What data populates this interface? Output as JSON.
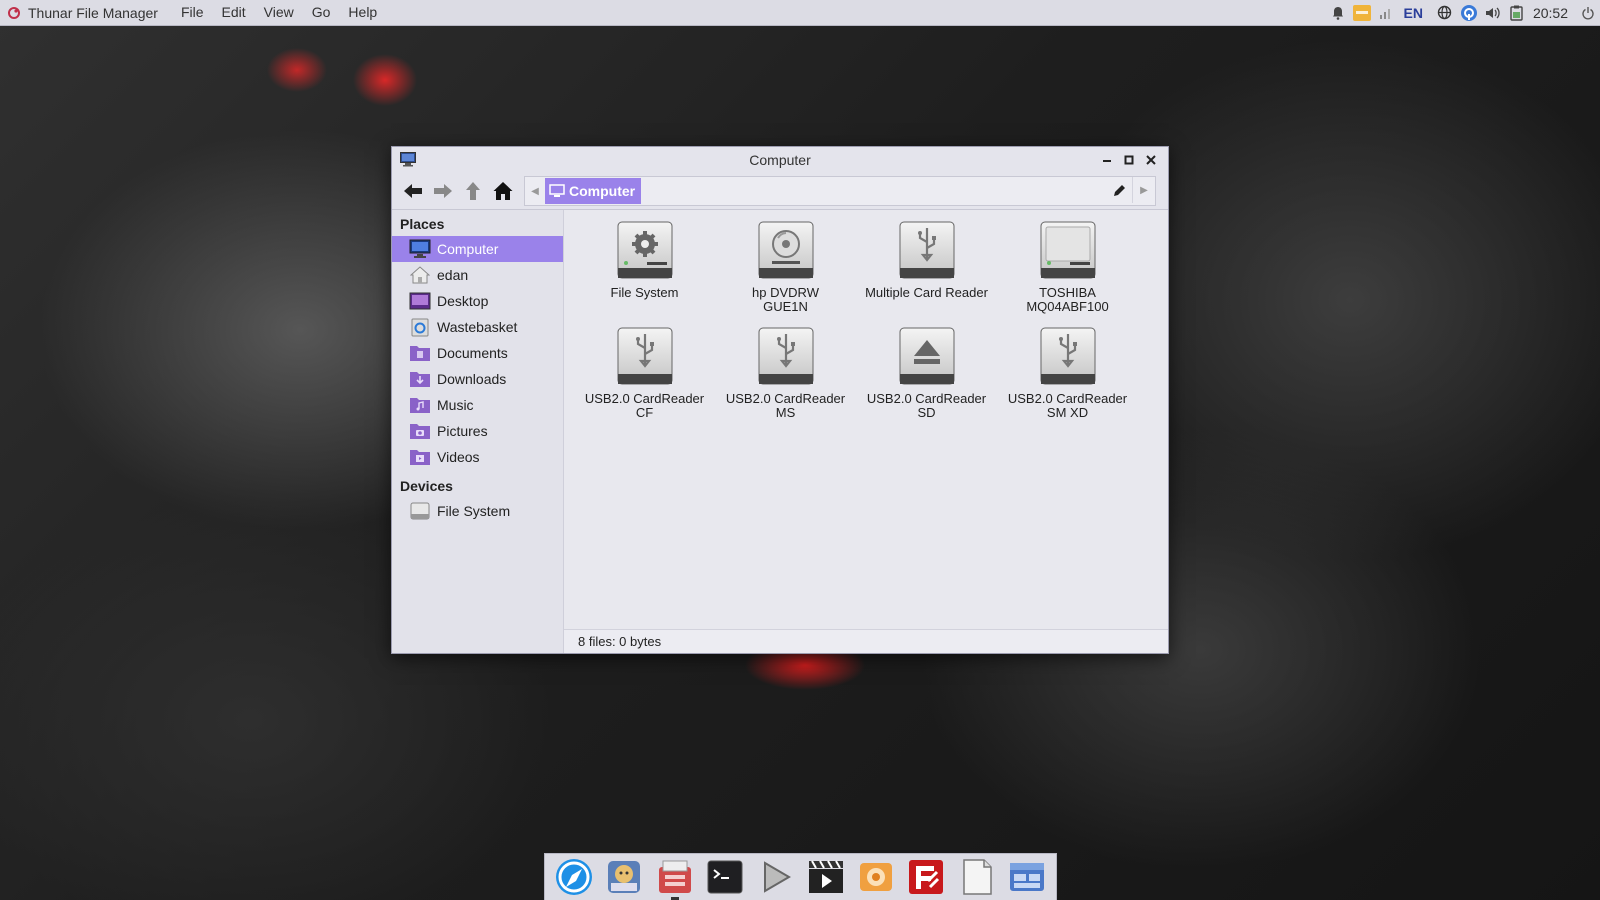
{
  "panel": {
    "app_name": "Thunar File Manager",
    "menu": [
      "File",
      "Edit",
      "View",
      "Go",
      "Help"
    ],
    "lang": "EN",
    "clock": "20:52"
  },
  "window": {
    "title": "Computer",
    "path_crumb": "Computer",
    "sidebar": {
      "places_title": "Places",
      "places": [
        "Computer",
        "edan",
        "Desktop",
        "Wastebasket",
        "Documents",
        "Downloads",
        "Music",
        "Pictures",
        "Videos"
      ],
      "devices_title": "Devices",
      "devices": [
        "File System"
      ]
    },
    "files": [
      {
        "label": "File System",
        "icon": "hard-drive-gear-icon"
      },
      {
        "label": "hp       DVDRW\nGUE1N",
        "icon": "optical-drive-icon"
      },
      {
        "label": "Multiple Card  Reader",
        "icon": "usb-drive-icon"
      },
      {
        "label": "TOSHIBA\nMQ04ABF100",
        "icon": "hard-disk-icon"
      },
      {
        "label": "USB2.0 CardReader\nCF",
        "icon": "usb-drive-icon"
      },
      {
        "label": "USB2.0 CardReader\nMS",
        "icon": "usb-drive-icon"
      },
      {
        "label": "USB2.0 CardReader\nSD",
        "icon": "eject-drive-icon"
      },
      {
        "label": "USB2.0 CardReader\nSM XD",
        "icon": "usb-drive-icon"
      }
    ],
    "status": "8 files: 0 bytes"
  },
  "colors": {
    "accent": "#9a82ea",
    "folder": "#8a62c8"
  },
  "dock": [
    "browser-icon",
    "mail-icon",
    "package-installer-icon",
    "terminal-icon",
    "media-player-icon",
    "video-player-icon",
    "image-viewer-icon",
    "filezilla-icon",
    "text-editor-icon",
    "desktop-switcher-icon"
  ]
}
